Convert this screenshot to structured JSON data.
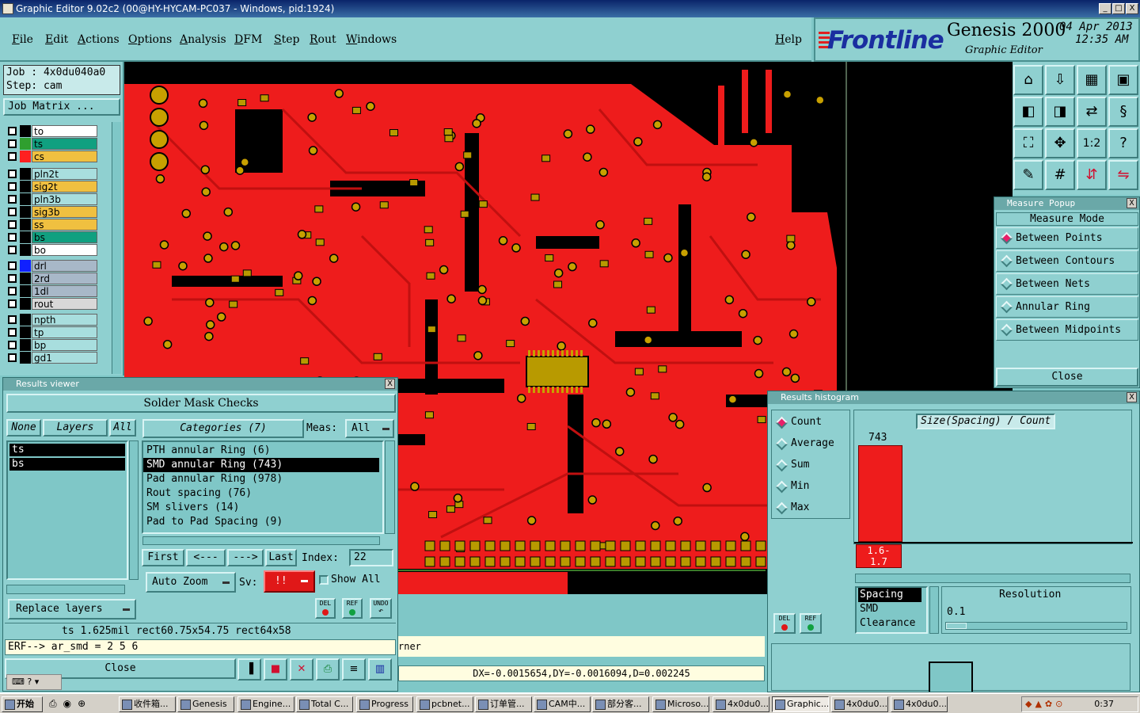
{
  "window": {
    "title": "Graphic Editor 9.02c2 (00@HY-HYCAM-PC037 - Windows, pid:1924)",
    "min": "_",
    "max": "□",
    "close": "X"
  },
  "menu": {
    "items": [
      "File",
      "Edit",
      "Actions",
      "Options",
      "Analysis",
      "DFM",
      "Step",
      "Rout",
      "Windows"
    ],
    "help": "Help"
  },
  "brand": {
    "logo": "Frontline",
    "product": "Genesis 2000",
    "subtitle": "Graphic Editor",
    "date": "04 Apr 2013",
    "time": "12:35 AM"
  },
  "job": {
    "job_line": "Job : 4x0du040a0",
    "step_line": "Step: cam",
    "matrix_button": "Job Matrix ..."
  },
  "layers": [
    {
      "name": "to",
      "color": "#ffffff",
      "swatch": "#000000"
    },
    {
      "name": "ts",
      "color": "#10a080",
      "swatch": "#2f9f2f"
    },
    {
      "name": "cs",
      "color": "#f0c040",
      "swatch": "#ff2020"
    },
    {
      "name": "pln2t",
      "color": "#a8dede",
      "swatch": "#000000"
    },
    {
      "name": "sig2t",
      "color": "#f0c040",
      "swatch": "#000000"
    },
    {
      "name": "pln3b",
      "color": "#a8dede",
      "swatch": "#000000"
    },
    {
      "name": "sig3b",
      "color": "#f0c040",
      "swatch": "#000000"
    },
    {
      "name": "ss",
      "color": "#f0c040",
      "swatch": "#000000"
    },
    {
      "name": "bs",
      "color": "#10a080",
      "swatch": "#000000"
    },
    {
      "name": "bo",
      "color": "#ffffff",
      "swatch": "#000000"
    },
    {
      "name": "drl",
      "color": "#a8b8c8",
      "swatch": "#1020ff"
    },
    {
      "name": "2rd",
      "color": "#a8b8c8",
      "swatch": "#000000"
    },
    {
      "name": "1dl",
      "color": "#a8b8c8",
      "swatch": "#000000"
    },
    {
      "name": "rout",
      "color": "#d8d8d8",
      "swatch": "#000000"
    },
    {
      "name": "npth",
      "color": "#a8dede",
      "swatch": "#000000"
    },
    {
      "name": "tp",
      "color": "#a8dede",
      "swatch": "#000000"
    },
    {
      "name": "bp",
      "color": "#a8dede",
      "swatch": "#000000"
    },
    {
      "name": "gd1",
      "color": "#a8dede",
      "swatch": "#000000"
    }
  ],
  "measure": {
    "title": "Measure Popup",
    "mode_label": "Measure Mode",
    "modes": [
      "Between Points",
      "Between Contours",
      "Between Nets",
      "Annular Ring",
      "Between Midpoints"
    ],
    "close": "Close"
  },
  "results": {
    "title": "Results viewer",
    "heading": "Solder Mask Checks",
    "none": "None",
    "layers": "Layers",
    "all": "All",
    "categories_label": "Categories (7)",
    "meas_label": "Meas:",
    "meas_value": "All",
    "layer_list": [
      "ts",
      "bs"
    ],
    "category_list": [
      "PTH annular Ring (6)",
      "SMD annular Ring (743)",
      "Pad annular Ring (978)",
      "Rout spacing (76)",
      "SM slivers (14)",
      "Pad to Pad Spacing (9)"
    ],
    "first": "First",
    "prev": "<---",
    "next": "--->",
    "last": "Last",
    "index_label": "Index:",
    "index_value": "22",
    "auto_zoom": "Auto Zoom",
    "sv_label": "Sv:",
    "sv_value": "!!",
    "show_all": "Show All",
    "replace_layers": "Replace layers",
    "del": "DEL",
    "ref": "REF",
    "undo": "UNDO",
    "info_line": "ts 1.625mil   rect60.75x54.75   rect64x58",
    "erf_line": "ERF--> ar_smd = 2 5 6",
    "close": "Close"
  },
  "histogram": {
    "title": "Results histogram",
    "modes": [
      "Count",
      "Average",
      "Sum",
      "Min",
      "Max"
    ],
    "chart_label": "Size(Spacing) / Count",
    "bar_value": "743",
    "bar_range": "1.6- 1.7",
    "list": [
      "Spacing",
      "SMD",
      "Clearance"
    ],
    "resolution_label": "Resolution",
    "resolution_value": "0.1",
    "del": "DEL",
    "ref": "REF"
  },
  "status": {
    "coords": "DX=-0.0015654,DY=-0.0016094,D=0.002245",
    "corner": "rner"
  },
  "taskbar": {
    "start": "开始",
    "clock": "0:37",
    "tasks": [
      "收件箱...",
      "Genesis",
      "Engine...",
      "Total C...",
      "Progress",
      "pcbnet...",
      "订单管...",
      "CAM中...",
      "部分客...",
      "Microso...",
      "4x0du0...",
      "Graphic...",
      "4x0du0...",
      "4x0du0..."
    ]
  }
}
